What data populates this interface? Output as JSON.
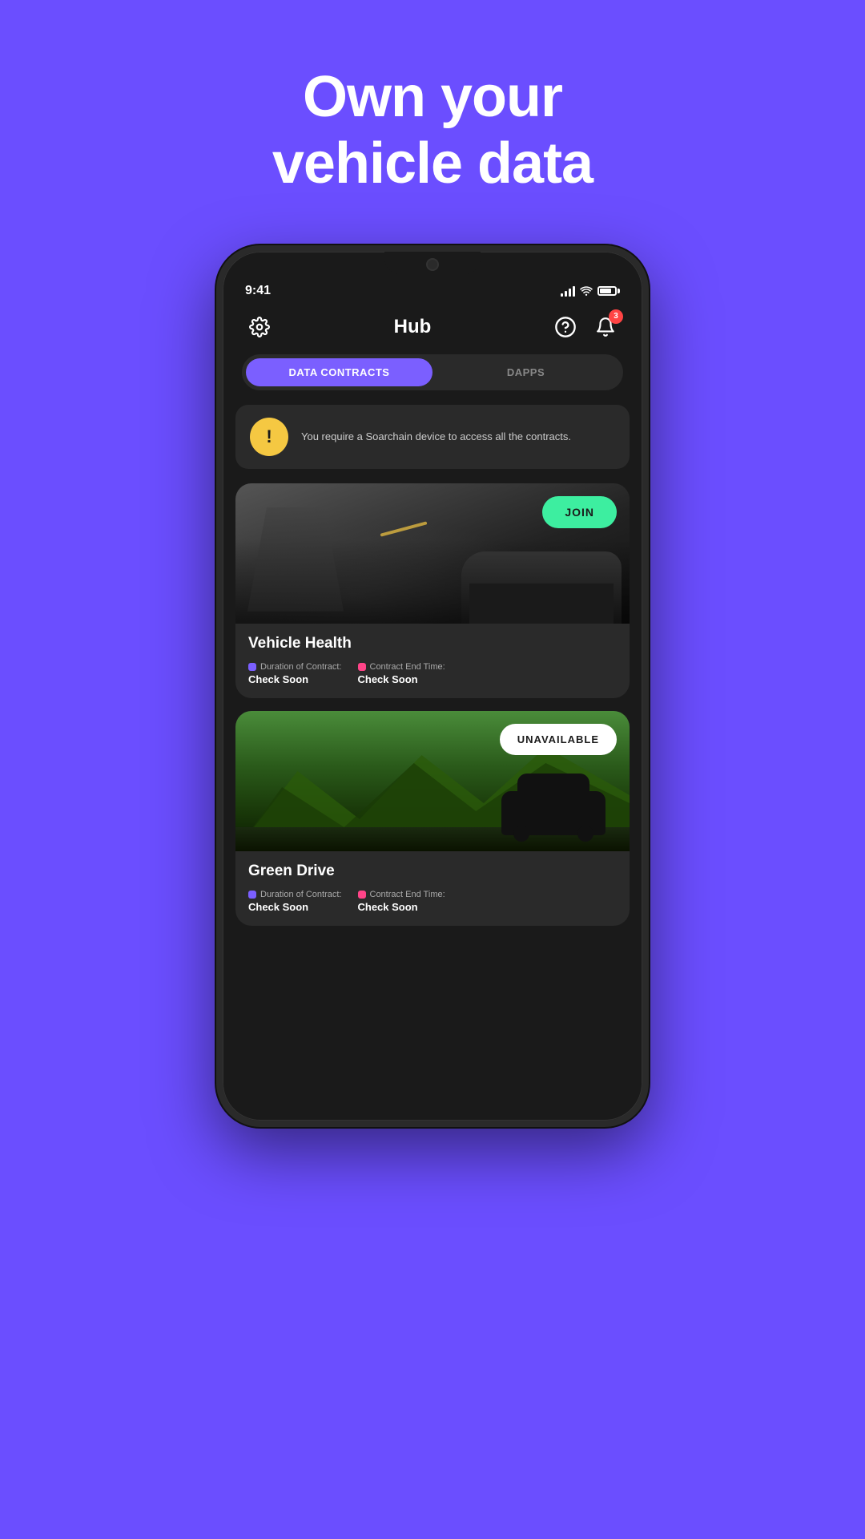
{
  "hero": {
    "line1": "Own your",
    "line2": "vehicle data"
  },
  "statusBar": {
    "time": "9:41",
    "notifCount": "3"
  },
  "header": {
    "title": "Hub"
  },
  "tabs": [
    {
      "id": "data-contracts",
      "label": "DATA CONTRACTS",
      "active": true
    },
    {
      "id": "dapps",
      "label": "DAPPS",
      "active": false
    }
  ],
  "warning": {
    "message": "You require a Soarchain device to access all the contracts."
  },
  "contracts": [
    {
      "id": "vehicle-health",
      "title": "Vehicle Health",
      "buttonLabel": "JOIN",
      "buttonType": "join",
      "durationLabel": "Duration of Contract:",
      "durationValue": "Check Soon",
      "endTimeLabel": "Contract End Time:",
      "endTimeValue": "Check Soon"
    },
    {
      "id": "green-drive",
      "title": "Green Drive",
      "buttonLabel": "UNAVAILABLE",
      "buttonType": "unavailable",
      "durationLabel": "Duration of Contract:",
      "durationValue": "Check Soon",
      "endTimeLabel": "Contract End Time:",
      "endTimeValue": "Check Soon"
    }
  ],
  "icons": {
    "settings": "⚙",
    "help": "?",
    "bell": "🔔",
    "warning": "!"
  }
}
